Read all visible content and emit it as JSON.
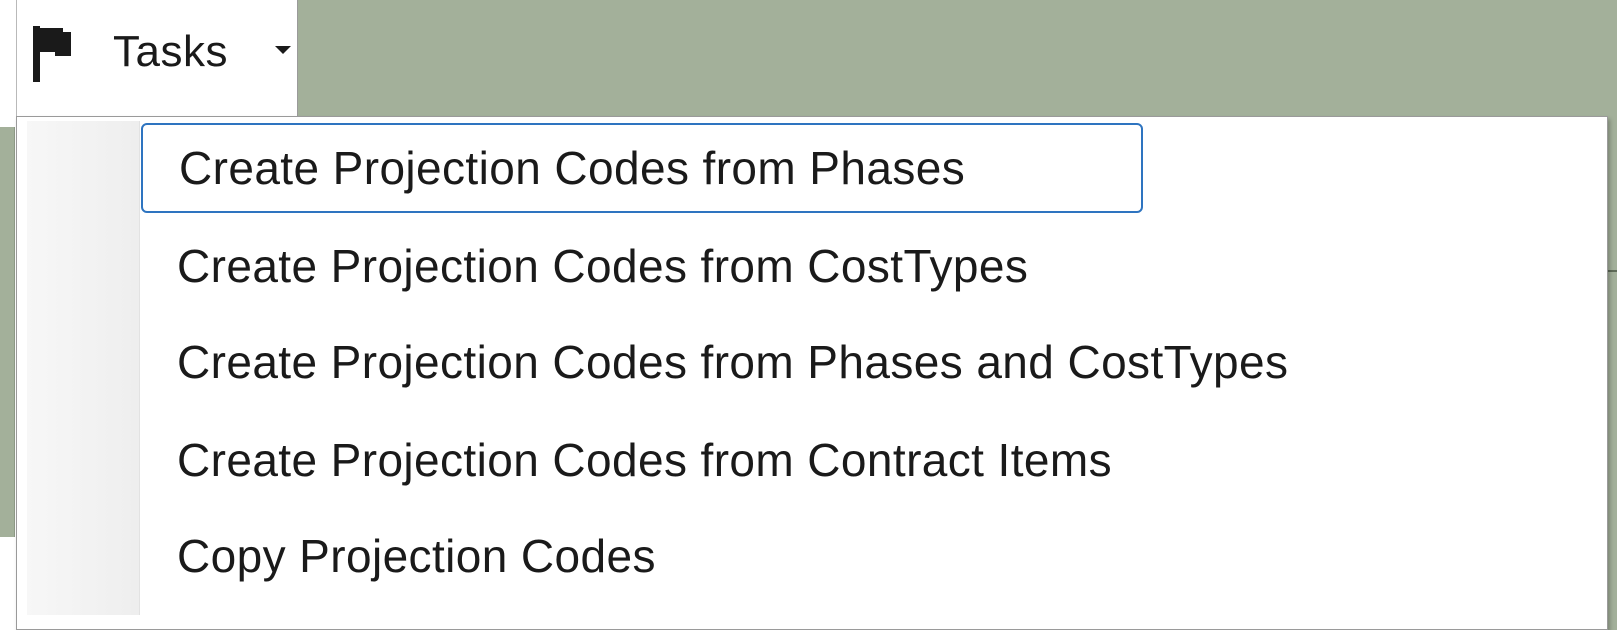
{
  "toolbar": {
    "tasks_label": "Tasks",
    "tasks_icon": "flag-icon",
    "dropdown_icon": "caret-down-icon"
  },
  "menu": {
    "focused_index": 0,
    "items": [
      {
        "label": "Create Projection Codes from Phases"
      },
      {
        "label": "Create Projection Codes from CostTypes"
      },
      {
        "label": "Create Projection Codes from Phases and CostTypes"
      },
      {
        "label": "Create Projection Codes from Contract Items"
      },
      {
        "label": "Copy Projection Codes"
      }
    ]
  },
  "colors": {
    "background": "#a3b09a",
    "focus_border": "#2e74c0",
    "menu_background": "#ffffff",
    "text": "#1a1a1a"
  }
}
